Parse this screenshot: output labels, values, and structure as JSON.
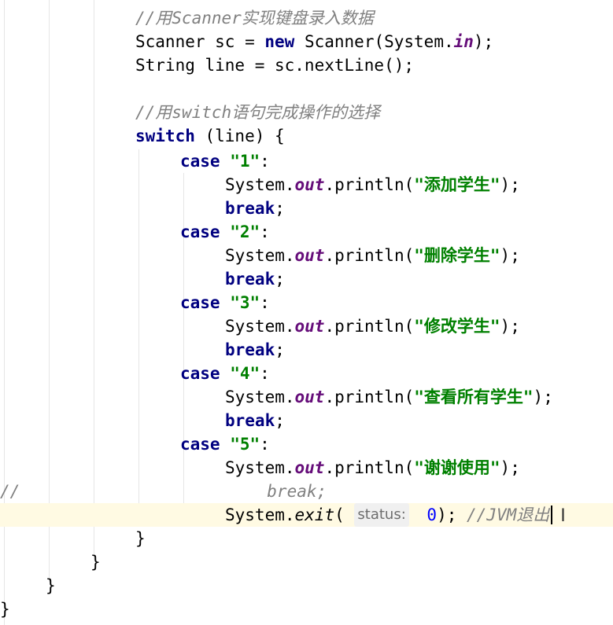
{
  "editor": {
    "language": "Java",
    "lines": [
      {
        "id": "comment-scanner",
        "parts": [
          {
            "t": "//用Scanner实现键盘录入数据",
            "c": "comment"
          }
        ]
      },
      {
        "id": "scanner-decl",
        "parts": [
          {
            "t": "Scanner sc = ",
            "c": ""
          },
          {
            "t": "new",
            "c": "kw"
          },
          {
            "t": " Scanner(System.",
            "c": ""
          },
          {
            "t": "in",
            "c": "field"
          },
          {
            "t": ");",
            "c": ""
          }
        ]
      },
      {
        "id": "line-decl",
        "parts": [
          {
            "t": "String line = sc.nextLine();",
            "c": ""
          }
        ]
      },
      {
        "id": "blank",
        "parts": []
      },
      {
        "id": "comment-switch",
        "parts": [
          {
            "t": "//用switch语句完成操作的选择",
            "c": "comment"
          }
        ]
      },
      {
        "id": "switch-head",
        "parts": [
          {
            "t": "switch",
            "c": "kw"
          },
          {
            "t": " (line) {",
            "c": ""
          }
        ]
      },
      {
        "id": "case-1",
        "parts": [
          {
            "t": "case",
            "c": "kw"
          },
          {
            "t": " ",
            "c": ""
          },
          {
            "t": "\"1\"",
            "c": "str"
          },
          {
            "t": ":",
            "c": ""
          }
        ]
      },
      {
        "id": "print-1",
        "parts": [
          {
            "t": "System.",
            "c": ""
          },
          {
            "t": "out",
            "c": "field"
          },
          {
            "t": ".println(",
            "c": ""
          },
          {
            "t": "\"添加学生\"",
            "c": "str"
          },
          {
            "t": ");",
            "c": ""
          }
        ]
      },
      {
        "id": "break-1",
        "parts": [
          {
            "t": "break",
            "c": "kw"
          },
          {
            "t": ";",
            "c": ""
          }
        ]
      },
      {
        "id": "case-2",
        "parts": [
          {
            "t": "case",
            "c": "kw"
          },
          {
            "t": " ",
            "c": ""
          },
          {
            "t": "\"2\"",
            "c": "str"
          },
          {
            "t": ":",
            "c": ""
          }
        ]
      },
      {
        "id": "print-2",
        "parts": [
          {
            "t": "System.",
            "c": ""
          },
          {
            "t": "out",
            "c": "field"
          },
          {
            "t": ".println(",
            "c": ""
          },
          {
            "t": "\"删除学生\"",
            "c": "str"
          },
          {
            "t": ");",
            "c": ""
          }
        ]
      },
      {
        "id": "break-2",
        "parts": [
          {
            "t": "break",
            "c": "kw"
          },
          {
            "t": ";",
            "c": ""
          }
        ]
      },
      {
        "id": "case-3",
        "parts": [
          {
            "t": "case",
            "c": "kw"
          },
          {
            "t": " ",
            "c": ""
          },
          {
            "t": "\"3\"",
            "c": "str"
          },
          {
            "t": ":",
            "c": ""
          }
        ]
      },
      {
        "id": "print-3",
        "parts": [
          {
            "t": "System.",
            "c": ""
          },
          {
            "t": "out",
            "c": "field"
          },
          {
            "t": ".println(",
            "c": ""
          },
          {
            "t": "\"修改学生\"",
            "c": "str"
          },
          {
            "t": ");",
            "c": ""
          }
        ]
      },
      {
        "id": "break-3",
        "parts": [
          {
            "t": "break",
            "c": "kw"
          },
          {
            "t": ";",
            "c": ""
          }
        ]
      },
      {
        "id": "case-4",
        "parts": [
          {
            "t": "case",
            "c": "kw"
          },
          {
            "t": " ",
            "c": ""
          },
          {
            "t": "\"4\"",
            "c": "str"
          },
          {
            "t": ":",
            "c": ""
          }
        ]
      },
      {
        "id": "print-4",
        "parts": [
          {
            "t": "System.",
            "c": ""
          },
          {
            "t": "out",
            "c": "field"
          },
          {
            "t": ".println(",
            "c": ""
          },
          {
            "t": "\"查看所有学生\"",
            "c": "str"
          },
          {
            "t": ");",
            "c": ""
          }
        ]
      },
      {
        "id": "break-4",
        "parts": [
          {
            "t": "break",
            "c": "kw"
          },
          {
            "t": ";",
            "c": ""
          }
        ]
      },
      {
        "id": "case-5",
        "parts": [
          {
            "t": "case",
            "c": "kw"
          },
          {
            "t": " ",
            "c": ""
          },
          {
            "t": "\"5\"",
            "c": "str"
          },
          {
            "t": ":",
            "c": ""
          }
        ]
      },
      {
        "id": "print-5",
        "parts": [
          {
            "t": "System.",
            "c": ""
          },
          {
            "t": "out",
            "c": "field"
          },
          {
            "t": ".println(",
            "c": ""
          },
          {
            "t": "\"谢谢使用\"",
            "c": "str"
          },
          {
            "t": ");",
            "c": ""
          }
        ]
      },
      {
        "id": "break-5-commented",
        "parts": [
          {
            "t": "  break;",
            "c": "comment"
          }
        ],
        "gutter_comment": "//"
      },
      {
        "id": "exit-call",
        "current": true,
        "parts": [
          {
            "t": "System.",
            "c": ""
          },
          {
            "t": "exit",
            "c": "static"
          },
          {
            "t": "( ",
            "c": ""
          },
          {
            "t": "status:",
            "c": "hint"
          },
          {
            "t": " ",
            "c": ""
          },
          {
            "t": "0",
            "c": "num"
          },
          {
            "t": "); ",
            "c": ""
          },
          {
            "t": "//JVM退出",
            "c": "comment"
          }
        ]
      },
      {
        "id": "close-switch",
        "parts": [
          {
            "t": "}",
            "c": ""
          }
        ]
      },
      {
        "id": "close-while",
        "parts": [
          {
            "t": "}",
            "c": ""
          }
        ]
      },
      {
        "id": "close-method",
        "parts": [
          {
            "t": "}",
            "c": ""
          }
        ]
      },
      {
        "id": "close-class",
        "parts": [
          {
            "t": "}",
            "c": ""
          }
        ]
      }
    ]
  }
}
